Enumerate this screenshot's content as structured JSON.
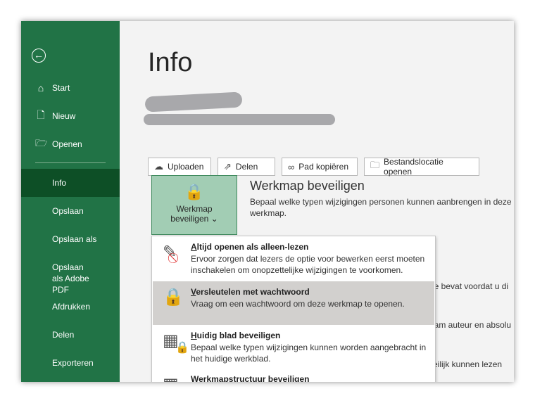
{
  "sidebar": {
    "back_icon": "arrow-left-circle-icon",
    "items": [
      {
        "label": "Start",
        "icon": "home-icon"
      },
      {
        "label": "Nieuw",
        "icon": "new-document-icon"
      },
      {
        "label": "Openen",
        "icon": "folder-open-icon"
      },
      {
        "label": "Info"
      },
      {
        "label": "Opslaan"
      },
      {
        "label": "Opslaan als"
      },
      {
        "label": "Opslaan als Adobe PDF"
      },
      {
        "label": "Afdrukken"
      },
      {
        "label": "Delen"
      },
      {
        "label": "Exporteren"
      }
    ],
    "selected": "Info",
    "colors": {
      "bg": "#217346",
      "selected": "#0d4f26"
    }
  },
  "main": {
    "title": "Info",
    "actions": [
      {
        "label": "Uploaden",
        "icon": "cloud-upload-icon"
      },
      {
        "label": "Delen",
        "icon": "share-icon"
      },
      {
        "label": "Pad kopiëren",
        "icon": "link-icon"
      },
      {
        "label": "Bestandslocatie openen",
        "icon": "folder-icon"
      }
    ],
    "protect_button": {
      "line1": "Werkmap",
      "line2": "beveiligen",
      "chevron": "⌄"
    },
    "section": {
      "heading": "Werkmap beveiligen",
      "description": "Bepaal welke typen wijzigingen personen kunnen aanbrengen in deze werkmap."
    },
    "background_fragments": [
      "de bevat voordat u di",
      "aam auteur en absolu",
      "eilijk kunnen lezen"
    ]
  },
  "menu": {
    "items": [
      {
        "title": "Altijd openen als alleen-lezen",
        "accel": "A",
        "rest": "ltijd openen als alleen-lezen",
        "description": "Ervoor zorgen dat lezers de optie voor bewerken eerst moeten inschakelen om onopzettelijke wijzigingen te voorkomen.",
        "icon": "pencil-no-edit-icon"
      },
      {
        "title": "Versleutelen met wachtwoord",
        "accel": "V",
        "rest": "ersleutelen met wachtwoord",
        "description": "Vraag om een wachtwoord om deze werkmap te openen.",
        "icon": "lock-key-icon",
        "highlighted": true
      },
      {
        "title": "Huidig blad beveiligen",
        "accel": "H",
        "rest": "uidig blad beveiligen",
        "description": "Bepaal welke typen wijzigingen kunnen worden aangebracht in het huidige werkblad.",
        "icon": "sheet-lock-icon"
      },
      {
        "title": "Werkmapstructuur beveiligen",
        "accel": "W",
        "rest": "erkmapstructuur beveiligen",
        "description": "",
        "icon": "workbook-structure-icon"
      }
    ]
  }
}
